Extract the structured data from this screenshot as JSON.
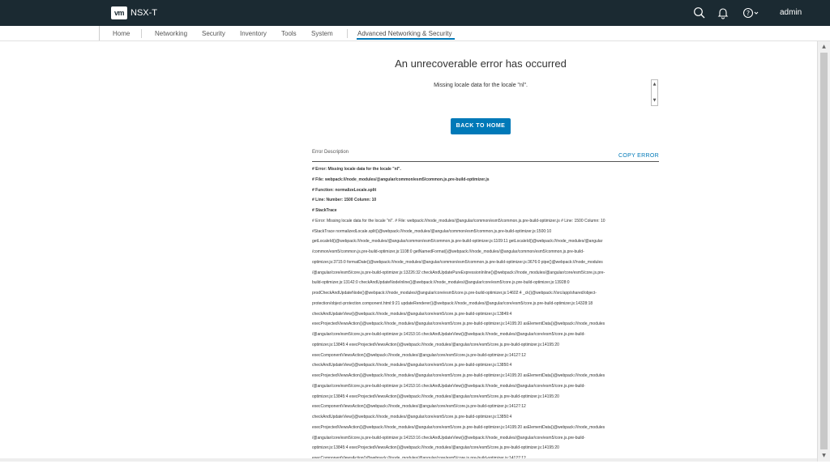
{
  "header": {
    "logo_text": "vm",
    "app_title": "NSX-T",
    "user": "admin",
    "icons": [
      "search-icon",
      "bell-icon",
      "help-icon"
    ]
  },
  "nav": {
    "items": [
      "Home",
      "Networking",
      "Security",
      "Inventory",
      "Tools",
      "System",
      "Advanced Networking & Security"
    ],
    "active": "Advanced Networking & Security"
  },
  "error": {
    "title": "An unrecoverable error has occurred",
    "message": "Missing locale data for the locale \"nl\".",
    "home_button": "BACK TO HOME",
    "description_label": "Error Description",
    "copy_label": "COPY ERROR",
    "lines": [
      {
        "text": "# Error: Missing locale data for the locale \"nl\".",
        "bold": true
      },
      {
        "text": "# File: webpack:///node_modules/@angular/common/esm5/common.js.pre-build-optimizer.js",
        "bold": true
      },
      {
        "text": "# Function: normalizeLocale.split",
        "bold": true
      },
      {
        "text": "# Line: Number: 1500 Column: 10",
        "bold": true
      },
      {
        "text": "# StackTrace",
        "bold": true
      },
      {
        "text": "# Error: Missing locale data for the locale \"nl\". # File: webpack:///node_modules/@angular/common/esm5/common.js.pre-build-optimizer.js # Line: 1500 Column: 10",
        "bold": false
      },
      {
        "text": "#StackTrace normalizedLocale.split()@webpack:///node_modules/@angular/common/esm5/common.js.pre-build-optimizer.js:1500:10",
        "bold": false
      },
      {
        "text": "getLocaleId()@webpack:///node_modules/@angular/common/esm5/common.js.pre-build-optimizer.js:1109:11 getLocaleId()@webpack:///node_modules/@angular",
        "bold": false
      },
      {
        "text": "/common/esm5/common.js.pre-build-optimizer.js:1108:0 getNamedFormat()@webpack:///node_modules/@angular/common/esm5/common.js.pre-build-",
        "bold": false
      },
      {
        "text": "optimizer.js:3715:0 formatDate()@webpack:///node_modules/@angular/common/esm5/common.js.pre-build-optimizer.js:3676:0 pipe()@webpack:///node_modules",
        "bold": false
      },
      {
        "text": "/@angular/core/esm5/core.js.pre-build-optimizer.js:13226:32 checkAndUpdatePureExpressionInline()@webpack:///node_modules/@angular/core/esm5/core.js.pre-",
        "bold": false
      },
      {
        "text": "build-optimizer.js:13142:0 checkAndUpdateNodeInline()@webpack:///node_modules/@angular/core/esm5/core.js.pre-build-optimizer.js:13928:0",
        "bold": false
      },
      {
        "text": "prodCheckAndUpdateNode()@webpack:///node_modules/@angular/core/esm5/core.js.pre-build-optimizer.js:14602:4 _ck()@webpack:///src/app/shared/object-",
        "bold": false
      },
      {
        "text": "protection/object-protection.component.html:9:21 updateRenderer()@webpack:///node_modules/@angular/core/esm5/core.js.pre-build-optimizer.js:14328:18",
        "bold": false
      },
      {
        "text": "checkAndUpdateView()@webpack:///node_modules/@angular/core/esm5/core.js.pre-build-optimizer.js:13849:4",
        "bold": false
      },
      {
        "text": "execProjectedViewsAction()@webpack:///node_modules/@angular/core/esm5/core.js.pre-build-optimizer.js:14195:20 asElementData()@webpack:///node_modules",
        "bold": false
      },
      {
        "text": "/@angular/core/esm5/core.js.pre-build-optimizer.js:14153:16 checkAndUpdateView()@webpack:///node_modules/@angular/core/esm5/core.js.pre-build-",
        "bold": false
      },
      {
        "text": "optimizer.js:13845:4 execProjectedViewsAction()@webpack:///node_modules/@angular/core/esm5/core.js.pre-build-optimizer.js:14195:20",
        "bold": false
      },
      {
        "text": "execComponentViewsAction()@webpack:///node_modules/@angular/core/esm5/core.js.pre-build-optimizer.js:14127:12",
        "bold": false
      },
      {
        "text": "checkAndUpdateView()@webpack:///node_modules/@angular/core/esm5/core.js.pre-build-optimizer.js:13850:4",
        "bold": false
      },
      {
        "text": "execProjectedViewsAction()@webpack:///node_modules/@angular/core/esm5/core.js.pre-build-optimizer.js:14195:20 asElementData()@webpack:///node_modules",
        "bold": false
      },
      {
        "text": "/@angular/core/esm5/core.js.pre-build-optimizer.js:14153:16 checkAndUpdateView()@webpack:///node_modules/@angular/core/esm5/core.js.pre-build-",
        "bold": false
      },
      {
        "text": "optimizer.js:13845:4 execProjectedViewsAction()@webpack:///node_modules/@angular/core/esm5/core.js.pre-build-optimizer.js:14195:20",
        "bold": false
      },
      {
        "text": "execComponentViewsAction()@webpack:///node_modules/@angular/core/esm5/core.js.pre-build-optimizer.js:14127:12",
        "bold": false
      },
      {
        "text": "checkAndUpdateView()@webpack:///node_modules/@angular/core/esm5/core.js.pre-build-optimizer.js:13850:4",
        "bold": false
      },
      {
        "text": "execProjectedViewsAction()@webpack:///node_modules/@angular/core/esm5/core.js.pre-build-optimizer.js:14195:20 asElementData()@webpack:///node_modules",
        "bold": false
      },
      {
        "text": "/@angular/core/esm5/core.js.pre-build-optimizer.js:14153:16 checkAndUpdateView()@webpack:///node_modules/@angular/core/esm5/core.js.pre-build-",
        "bold": false
      },
      {
        "text": "optimizer.js:13845:4 execProjectedViewsAction()@webpack:///node_modules/@angular/core/esm5/core.js.pre-build-optimizer.js:14195:20",
        "bold": false
      },
      {
        "text": "execComponentViewsAction()@webpack:///node_modules/@angular/core/esm5/core.js.pre-build-optimizer.js:14127:12",
        "bold": false
      }
    ]
  },
  "colors": {
    "header_bg": "#1b2a32",
    "accent": "#0079b8"
  }
}
